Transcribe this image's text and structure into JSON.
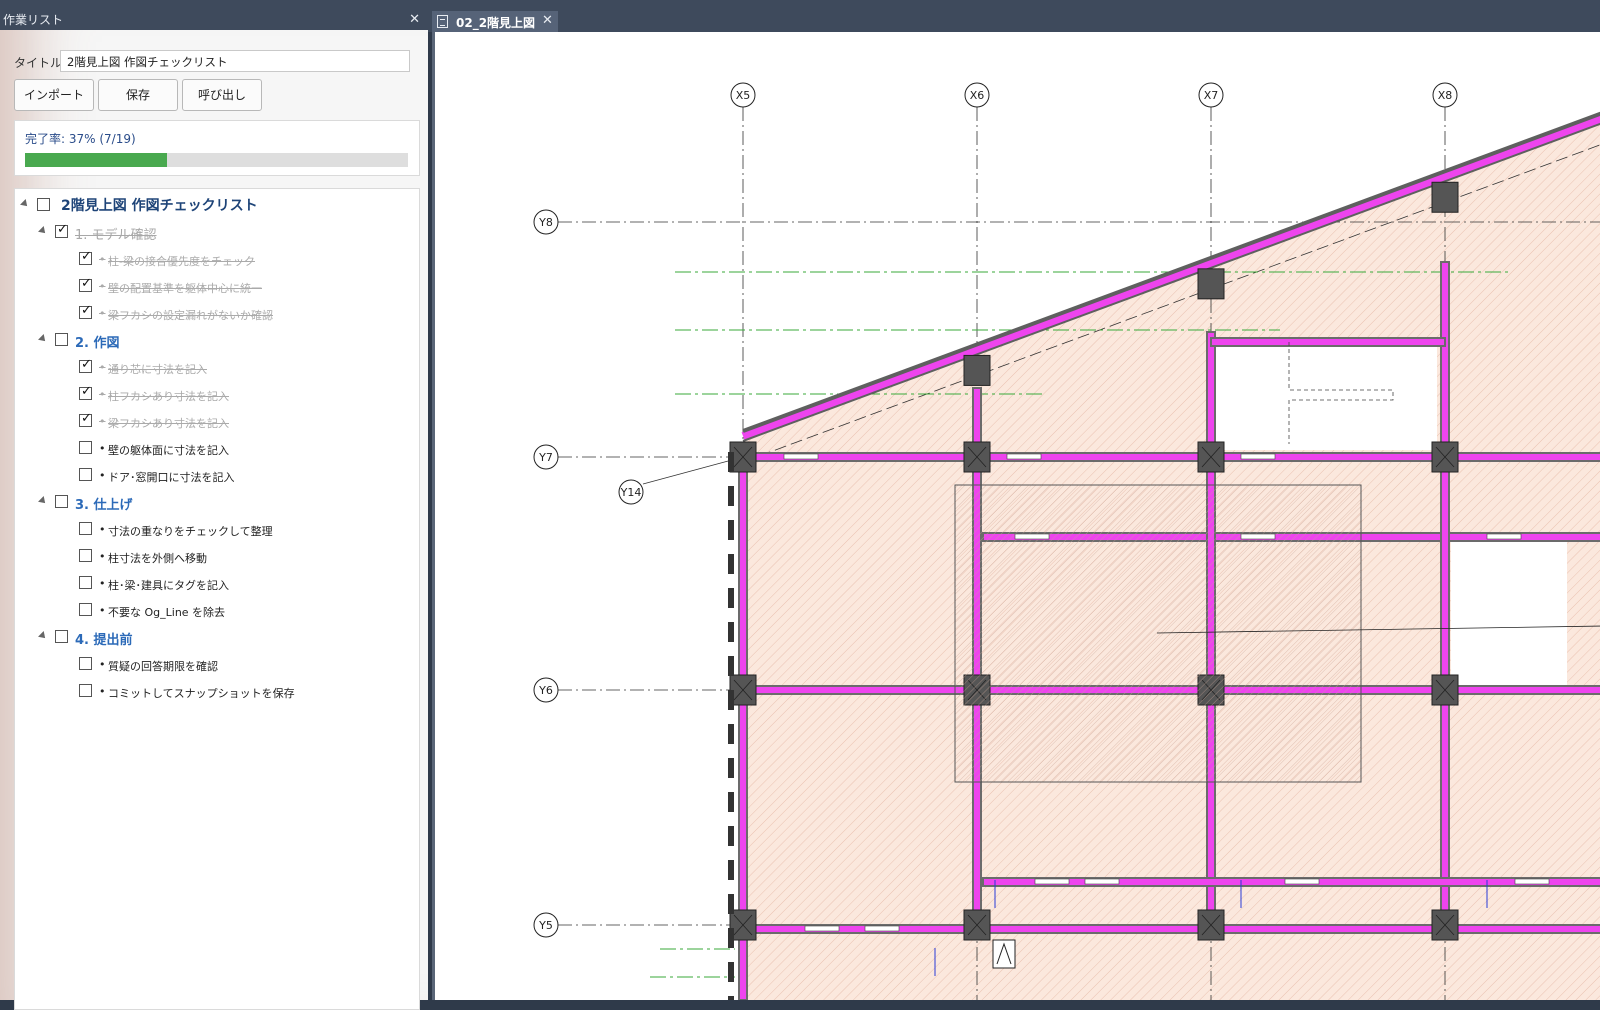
{
  "panel": {
    "header_title": "作業リスト",
    "close_glyph": "✕",
    "title_label": "タイトル:",
    "title_value": "2階見上図 作図チェックリスト",
    "buttons": {
      "import": "インポート",
      "save": "保存",
      "load": "呼び出し"
    },
    "progress_text": "完了率: 37% (7/19)",
    "progress_fraction": 0.37,
    "progress_color": "#49a94f"
  },
  "tree": {
    "root": {
      "label": "2階見上図 作図チェックリスト",
      "checked": false
    },
    "sections": [
      {
        "label": "1. モデル確認",
        "checked": true,
        "items": [
          {
            "label": "柱‐梁の接合優先度をチェック",
            "checked": true
          },
          {
            "label": "壁の配置基準を躯体中心に統一",
            "checked": true
          },
          {
            "label": "梁フカシの設定漏れがないか確認",
            "checked": true
          }
        ]
      },
      {
        "label": "2. 作図",
        "checked": false,
        "items": [
          {
            "label": "通り芯に寸法を記入",
            "checked": true
          },
          {
            "label": "柱フカシあり寸法を記入",
            "checked": true
          },
          {
            "label": "梁フカシあり寸法を記入",
            "checked": true
          },
          {
            "label": "壁の躯体面に寸法を記入",
            "checked": false
          },
          {
            "label": "ドア･窓開口に寸法を記入",
            "checked": false
          }
        ]
      },
      {
        "label": "3. 仕上げ",
        "checked": false,
        "items": [
          {
            "label": "寸法の重なりをチェックして整理",
            "checked": false
          },
          {
            "label": "柱寸法を外側へ移動",
            "checked": false
          },
          {
            "label": "柱･梁･建具にタグを記入",
            "checked": false
          },
          {
            "label": "不要な Og_Line を除去",
            "checked": false
          }
        ]
      },
      {
        "label": "4. 提出前",
        "checked": false,
        "items": [
          {
            "label": "質疑の回答期限を確認",
            "checked": false
          },
          {
            "label": "コミットしてスナップショットを保存",
            "checked": false
          }
        ]
      }
    ],
    "bullet": "•",
    "check_glyph": "✓"
  },
  "tab": {
    "label": "02_2階見上図",
    "close_glyph": "✕"
  },
  "drawing": {
    "grid_x": [
      "X5",
      "X6",
      "X7",
      "X8"
    ],
    "grid_y": [
      "Y8",
      "Y7",
      "Y14",
      "Y6",
      "Y5"
    ],
    "colors": {
      "beam": "#ee44ee",
      "column": "#555555",
      "slab": "#fbe8dd",
      "grid": "#333333",
      "green_line": "#3aaa3a"
    }
  }
}
